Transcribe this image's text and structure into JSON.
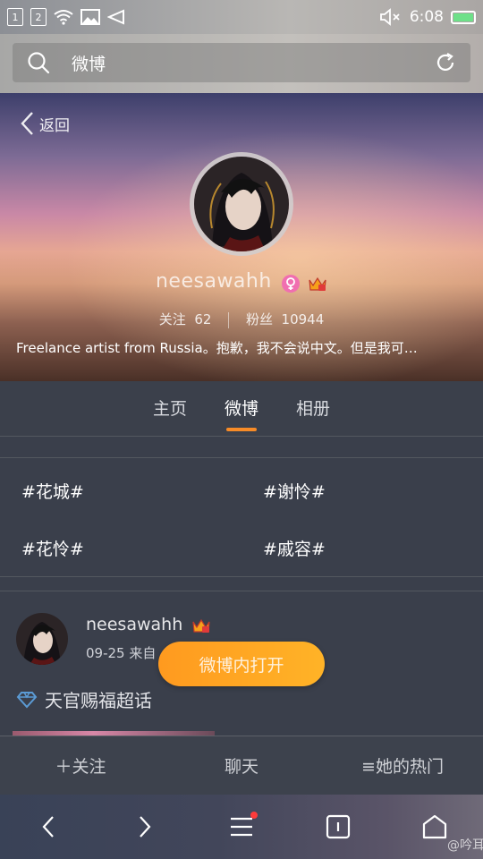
{
  "status_bar": {
    "sim1": "1",
    "sim2": "2",
    "time": "6:08"
  },
  "search": {
    "query": "微博"
  },
  "profile": {
    "back_label": "返回",
    "username": "neesawahh",
    "following_label": "关注",
    "following_count": "62",
    "followers_label": "粉丝",
    "followers_count": "10944",
    "bio": "Freelance artist from Russia。抱歉，我不会说中文。但是我可…"
  },
  "tabs": [
    {
      "label": "主页",
      "active": false
    },
    {
      "label": "微博",
      "active": true
    },
    {
      "label": "相册",
      "active": false
    }
  ],
  "hashtags": [
    "#花城#",
    "#谢怜#",
    "#花怜#",
    "#戚容#"
  ],
  "post": {
    "username": "neesawahh",
    "meta": "09-25 来自",
    "topic": "天官赐福超话"
  },
  "open_button": "微博内打开",
  "actions": {
    "follow": "关注",
    "chat": "聊天",
    "hot": "她的热门"
  },
  "watermark": "@吟耳",
  "colors": {
    "accent": "#f78b27",
    "open_button": "#ff9a1f",
    "badge_female": "#f06fb0",
    "battery": "#6ee089"
  }
}
